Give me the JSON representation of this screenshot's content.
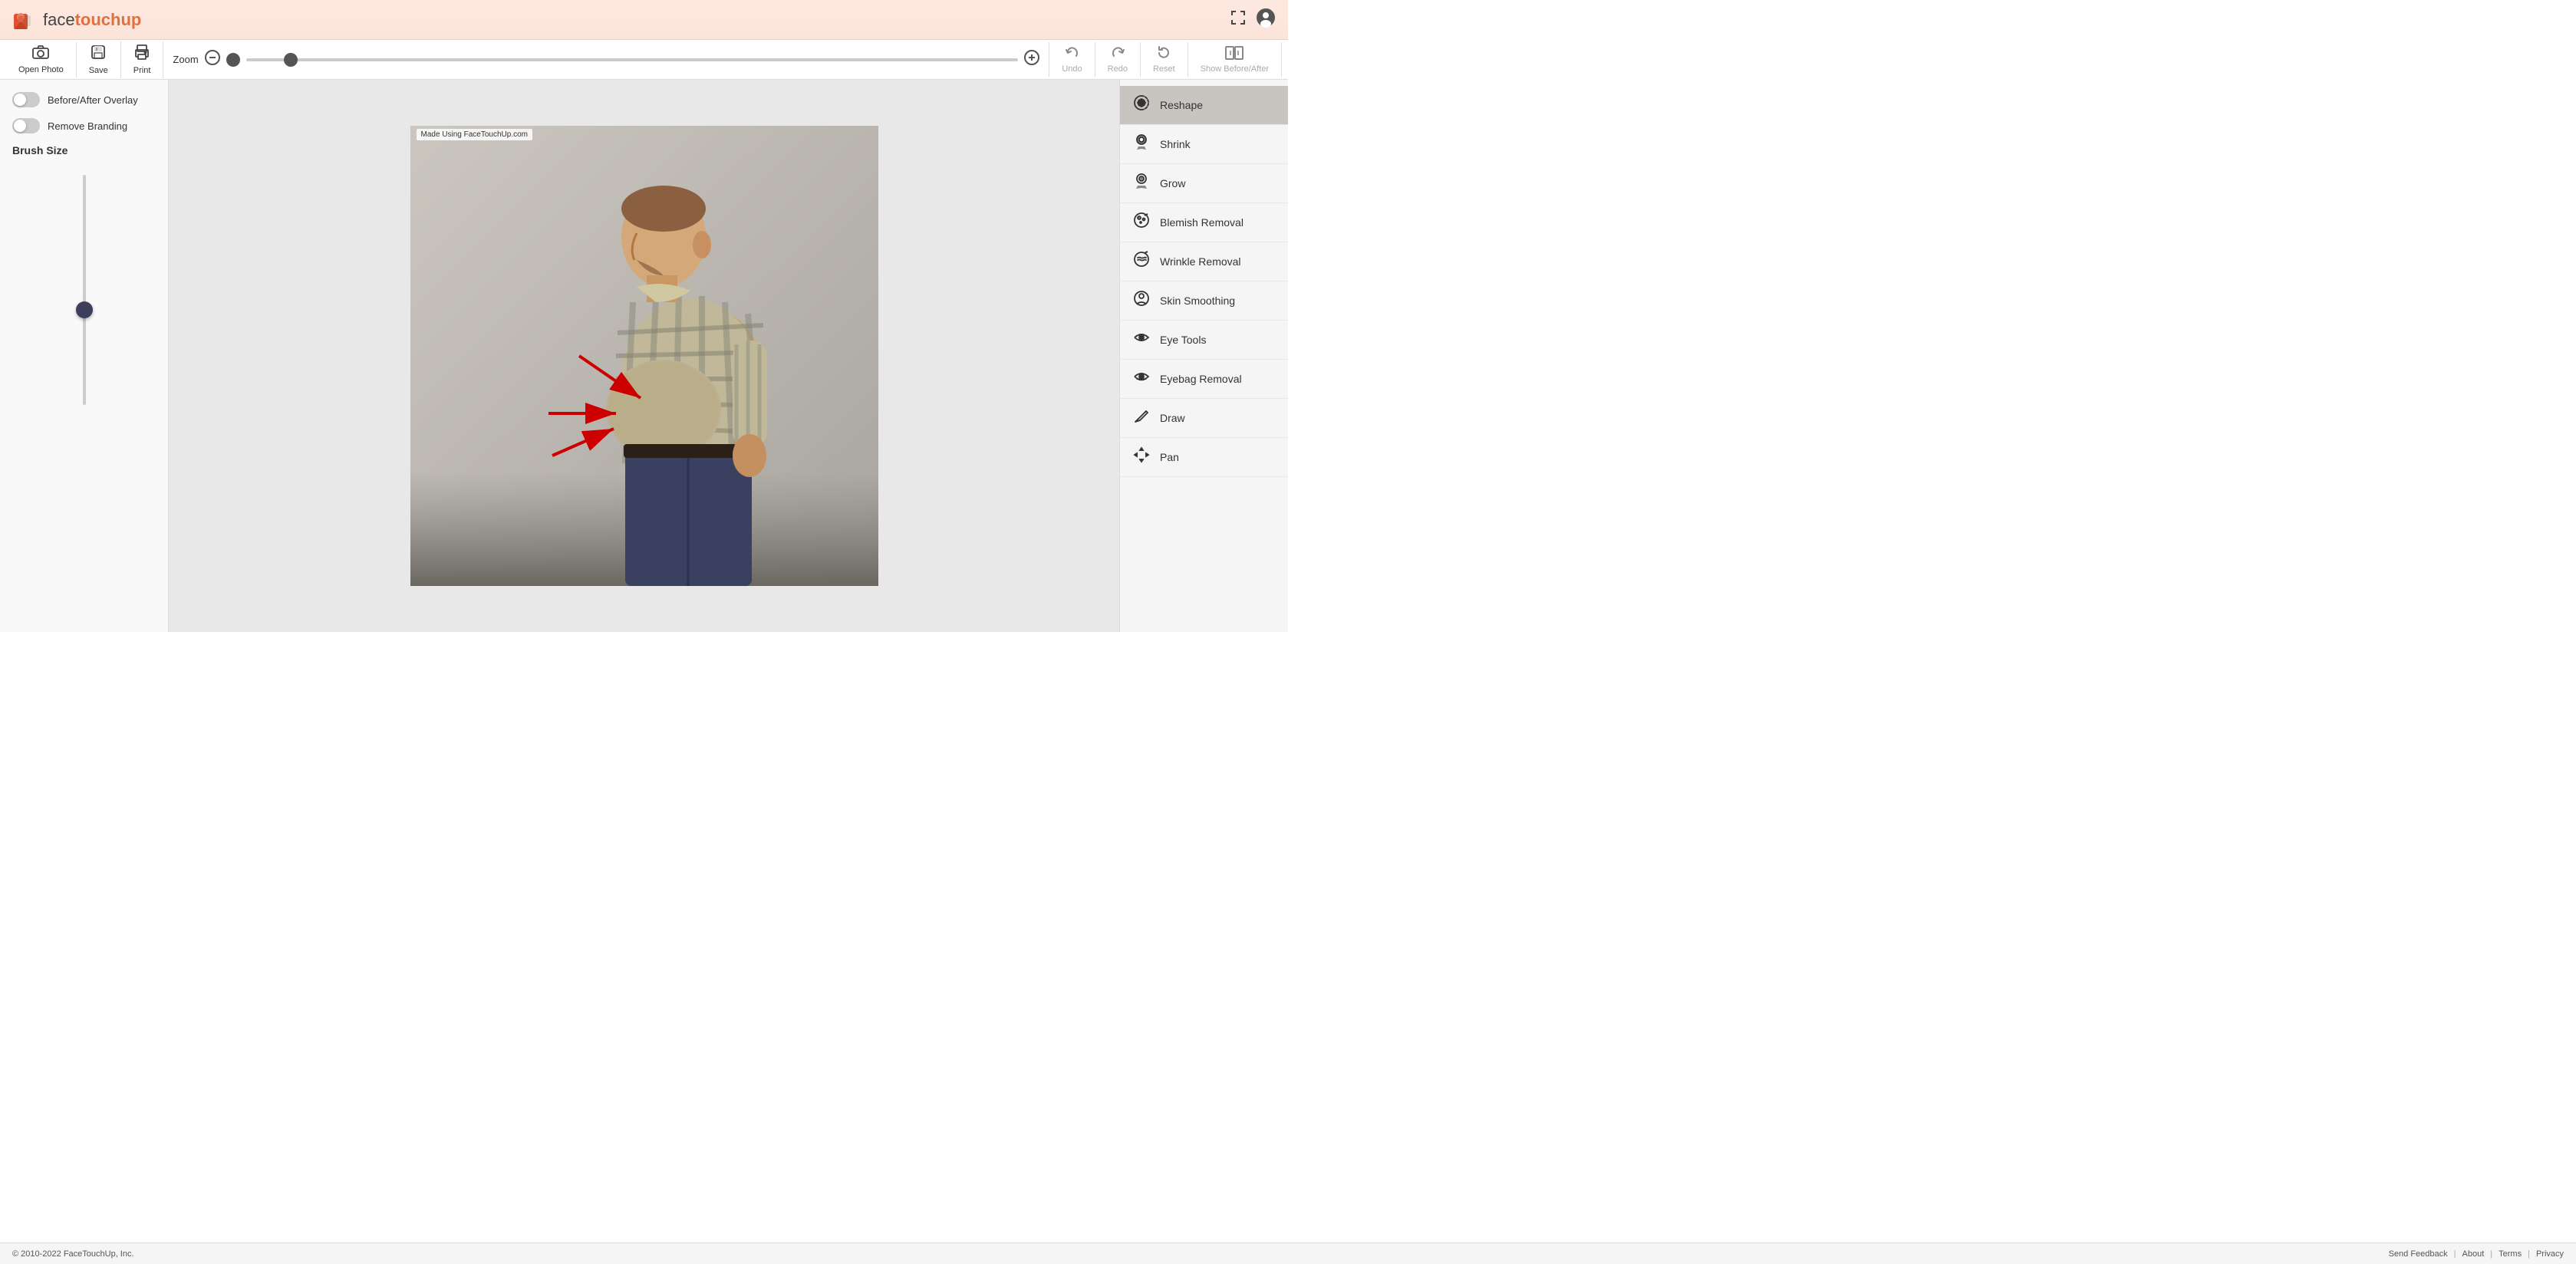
{
  "header": {
    "logo_face": "face",
    "logo_touchup": "touchup",
    "fullscreen_icon": "⛶",
    "account_icon": "👤"
  },
  "toolbar": {
    "open_photo_label": "Open Photo",
    "save_label": "Save",
    "print_label": "Print",
    "zoom_label": "Zoom",
    "undo_label": "Undo",
    "redo_label": "Redo",
    "reset_label": "Reset",
    "show_before_after_label": "Show Before/After"
  },
  "left_panel": {
    "before_after_overlay_label": "Before/After Overlay",
    "remove_branding_label": "Remove Branding",
    "brush_size_label": "Brush Size"
  },
  "right_panel": {
    "tools": [
      {
        "id": "reshape",
        "label": "Reshape",
        "icon": "reshape"
      },
      {
        "id": "shrink",
        "label": "Shrink",
        "icon": "shrink"
      },
      {
        "id": "grow",
        "label": "Grow",
        "icon": "grow"
      },
      {
        "id": "blemish-removal",
        "label": "Blemish Removal",
        "icon": "blemish"
      },
      {
        "id": "wrinkle-removal",
        "label": "Wrinkle Removal",
        "icon": "wrinkle"
      },
      {
        "id": "skin-smoothing",
        "label": "Skin Smoothing",
        "icon": "skin"
      },
      {
        "id": "eye-tools",
        "label": "Eye Tools",
        "icon": "eye"
      },
      {
        "id": "eyebag-removal",
        "label": "Eyebag Removal",
        "icon": "eyebag"
      },
      {
        "id": "draw",
        "label": "Draw",
        "icon": "draw"
      },
      {
        "id": "pan",
        "label": "Pan",
        "icon": "pan"
      }
    ]
  },
  "canvas": {
    "watermark_text": "Made Using FaceTouchUp.com"
  },
  "footer": {
    "copyright": "© 2010-2022 FaceTouchUp, Inc.",
    "send_feedback": "Send Feedback",
    "about": "About",
    "terms": "Terms",
    "privacy": "Privacy"
  }
}
